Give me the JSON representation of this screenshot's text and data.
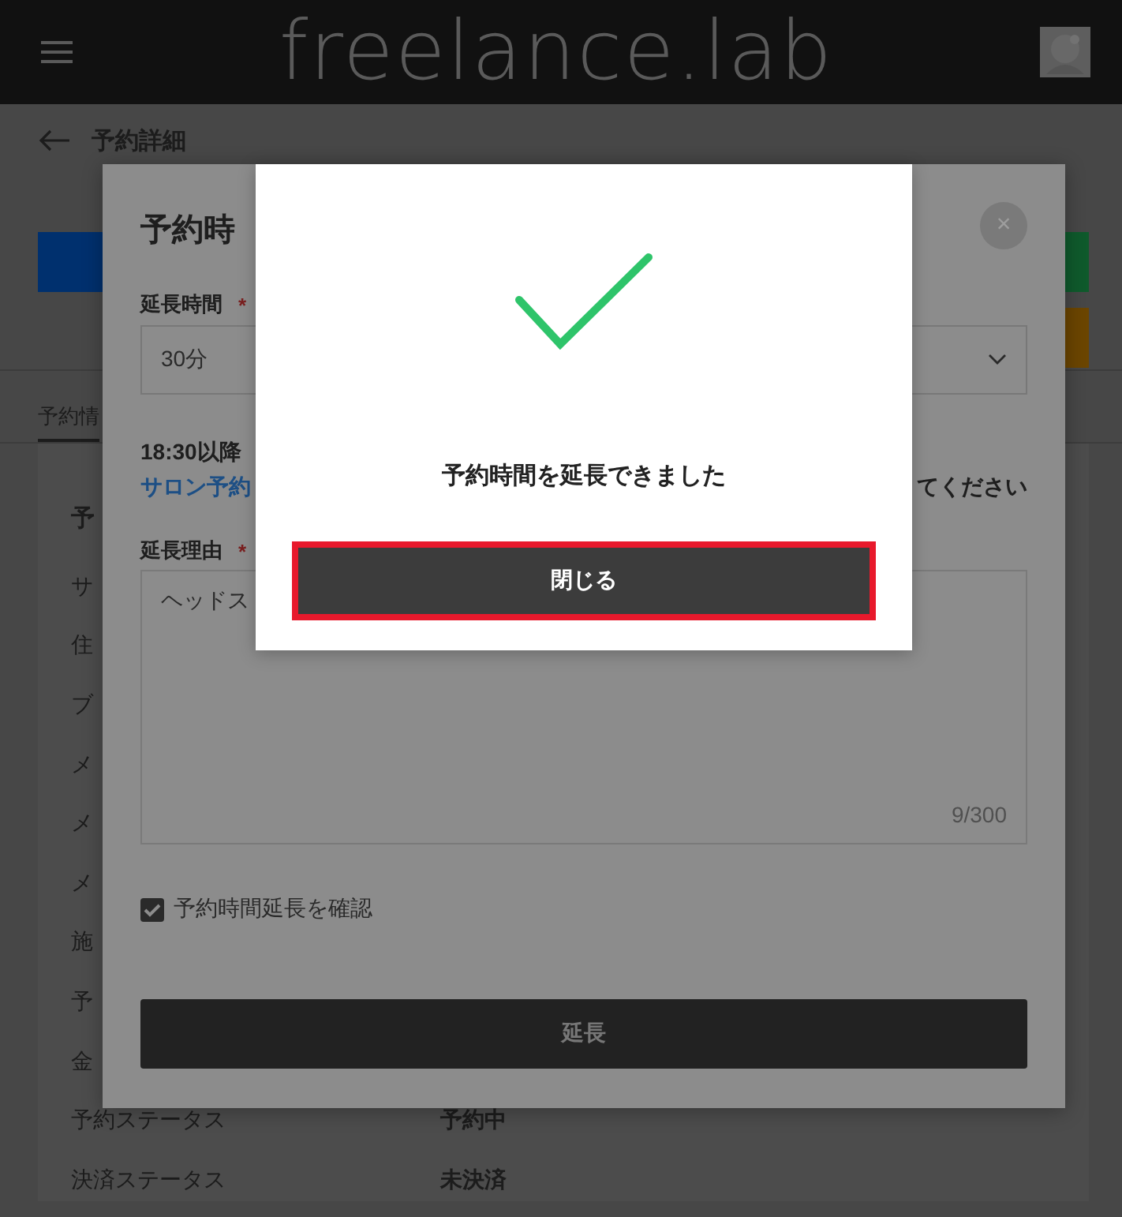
{
  "header": {
    "logo": "freelance.lab"
  },
  "page": {
    "title": "予約詳細",
    "left_buttons": [
      {
        "color": "#00306e"
      }
    ],
    "right_buttons": [
      {
        "color": "#0f5a2c"
      },
      {
        "color": "#6b4500"
      }
    ],
    "tabs": [
      {
        "label": "予約情",
        "selected": true
      }
    ],
    "section_title": "予",
    "rows": [
      {
        "label": "サ"
      },
      {
        "label": "住"
      },
      {
        "label": "ブ"
      },
      {
        "label": "メ"
      },
      {
        "label": "メ"
      },
      {
        "label": "メ"
      },
      {
        "label": "施"
      },
      {
        "label": "予"
      },
      {
        "label": "金"
      },
      {
        "label": "予約ステータス",
        "value": "予約中"
      },
      {
        "label": "決済ステータス",
        "value": "未決済"
      }
    ]
  },
  "extend_dialog": {
    "title": "予約時",
    "close": "×",
    "duration_label": "延長時間",
    "required_mark": "*",
    "duration_value": "30分",
    "notice": "18:30以降",
    "notice_link": "サロン予約",
    "notice_tail": "てください",
    "reason_label": "延長理由",
    "reason_required_mark": "*",
    "reason_value": "ヘッドス",
    "counter": "9/300",
    "confirm": {
      "label": "予約時間延長を確認",
      "checked": true
    },
    "submit": "延長"
  },
  "success_dialog": {
    "message": "予約時間を延長できました",
    "button": {
      "label": "閉じる",
      "highlighted": true
    }
  }
}
